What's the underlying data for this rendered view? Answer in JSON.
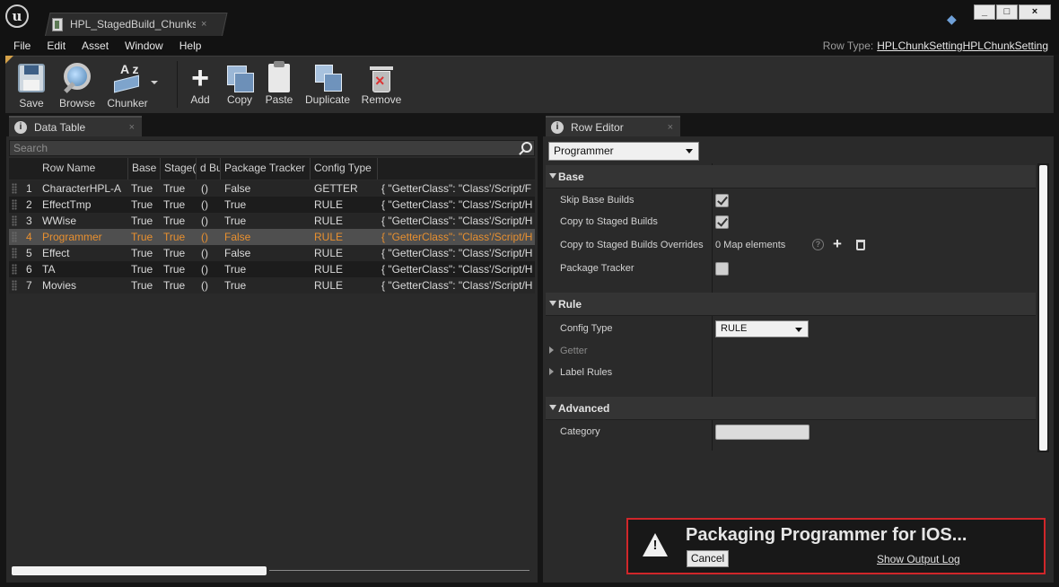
{
  "window": {
    "tab_title": "HPL_StagedBuild_Chunks",
    "tab_close": "×",
    "minimize": "_",
    "maximize": "□",
    "close": "×"
  },
  "menu": {
    "items": [
      "File",
      "Edit",
      "Asset",
      "Window",
      "Help"
    ],
    "row_type_label": "Row Type:",
    "row_type_value": "HPLChunkSettingHPLChunkSetting"
  },
  "toolbar": {
    "save": "Save",
    "browse": "Browse",
    "chunker": "Chunker",
    "chunker_glyph": "A z",
    "add": "Add",
    "copy": "Copy",
    "paste": "Paste",
    "duplicate": "Duplicate",
    "remove": "Remove"
  },
  "data_table": {
    "tab_label": "Data Table",
    "tab_close": "×",
    "search_placeholder": "Search",
    "columns": [
      "Row Name",
      "Base E",
      "Stage(",
      "d Bu",
      "Package Tracker",
      "Config Type",
      ""
    ],
    "rows": [
      {
        "index": "1",
        "name": "CharacterHPL-A",
        "base": "True",
        "staged": "True",
        "overrides": "()",
        "tracker": "False",
        "config": "GETTER",
        "extra": "{ \"GetterClass\": \"Class'/Script/F"
      },
      {
        "index": "2",
        "name": "EffectTmp",
        "base": "True",
        "staged": "True",
        "overrides": "()",
        "tracker": "True",
        "config": "RULE",
        "extra": "{ \"GetterClass\": \"Class'/Script/H"
      },
      {
        "index": "3",
        "name": "WWise",
        "base": "True",
        "staged": "True",
        "overrides": "()",
        "tracker": "True",
        "config": "RULE",
        "extra": "{ \"GetterClass\": \"Class'/Script/H"
      },
      {
        "index": "4",
        "name": "Programmer",
        "base": "True",
        "staged": "True",
        "overrides": "()",
        "tracker": "False",
        "config": "RULE",
        "extra": "{ \"GetterClass\": \"Class'/Script/H"
      },
      {
        "index": "5",
        "name": "Effect",
        "base": "True",
        "staged": "True",
        "overrides": "()",
        "tracker": "False",
        "config": "RULE",
        "extra": "{ \"GetterClass\": \"Class'/Script/H"
      },
      {
        "index": "6",
        "name": "TA",
        "base": "True",
        "staged": "True",
        "overrides": "()",
        "tracker": "True",
        "config": "RULE",
        "extra": "{ \"GetterClass\": \"Class'/Script/H"
      },
      {
        "index": "7",
        "name": "Movies",
        "base": "True",
        "staged": "True",
        "overrides": "()",
        "tracker": "True",
        "config": "RULE",
        "extra": "{ \"GetterClass\": \"Class'/Script/H"
      }
    ],
    "selected_row": 3,
    "selected_color": "#e9902f"
  },
  "row_editor": {
    "tab_label": "Row Editor",
    "tab_close": "×",
    "row_selector": "Programmer",
    "categories": {
      "base": "Base",
      "rule": "Rule",
      "advanced": "Advanced"
    },
    "props": {
      "skip_base_builds": "Skip Base Builds",
      "copy_to_staged": "Copy to Staged Builds",
      "copy_overrides": "Copy to Staged Builds Overrides",
      "package_tracker": "Package Tracker",
      "config_type": "Config Type",
      "getter": "Getter",
      "label_rules": "Label Rules",
      "category": "Category"
    },
    "map_elements": "0 Map elements",
    "help_glyph": "?",
    "config_type_value": "RULE",
    "skip_base_builds_checked": true,
    "copy_to_staged_checked": true,
    "package_tracker_checked": false
  },
  "notification": {
    "title": "Packaging Programmer for IOS...",
    "cancel": "Cancel",
    "show_log": "Show Output Log",
    "icon_glyph": "!",
    "border_color": "#d0262a"
  }
}
